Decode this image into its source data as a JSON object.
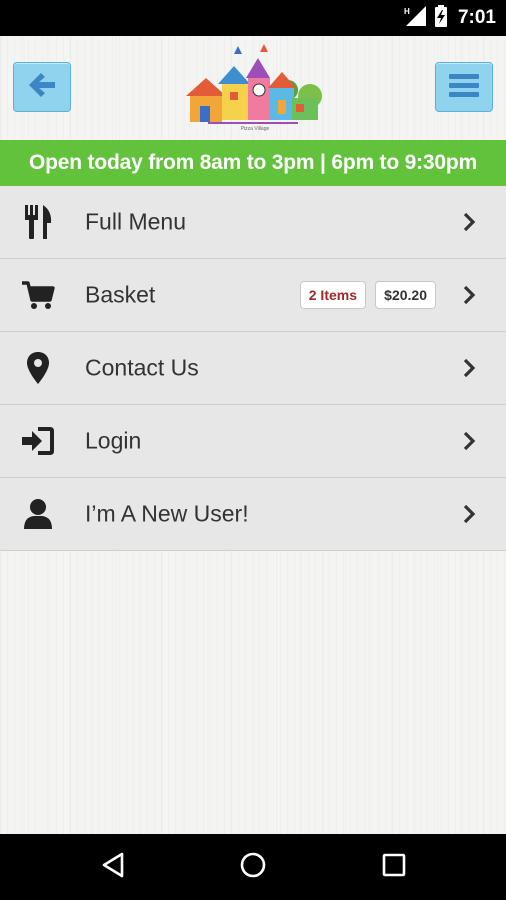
{
  "status_bar": {
    "time": "7:01",
    "network_label": "H",
    "icons": [
      "signal-icon",
      "battery-charging-icon"
    ]
  },
  "header": {
    "back_icon": "arrow-left-icon",
    "menu_icon": "hamburger-menu-icon",
    "logo_icon": "village-houses-logo",
    "logo_text": "Pizza Village"
  },
  "banner": {
    "text": "Open today from 8am to 3pm | 6pm to 9:30pm",
    "color": "#63c23b"
  },
  "menu": {
    "items": [
      {
        "label": "Full Menu",
        "icon": "fork-knife-icon"
      },
      {
        "label": "Basket",
        "icon": "shopping-cart-icon",
        "badge_items": "2 Items",
        "badge_price": "$20.20"
      },
      {
        "label": "Contact Us",
        "icon": "map-marker-icon"
      },
      {
        "label": "Login",
        "icon": "sign-in-icon"
      },
      {
        "label": "I’m A New User!",
        "icon": "user-icon"
      }
    ]
  },
  "nav_bar": {
    "icons": [
      "back-triangle-icon",
      "home-circle-icon",
      "recents-square-icon"
    ]
  },
  "colors": {
    "accent_button": "#8fd3ee",
    "accent_icon": "#3b87c6",
    "badge_items_text": "#a02a2a"
  }
}
